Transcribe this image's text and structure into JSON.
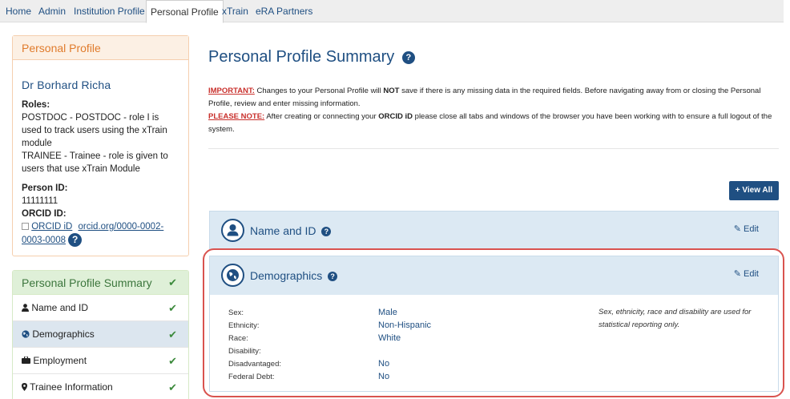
{
  "topnav": {
    "tabs": [
      "Home",
      "Admin",
      "Institution Profile",
      "Personal Profile",
      "xTrain",
      "eRA Partners"
    ],
    "active": "Personal Profile"
  },
  "profile": {
    "header": "Personal Profile",
    "name": "Dr Borhard  Richa",
    "roles_label": "Roles:",
    "roles": [
      "POSTDOC - POSTDOC - role I is used to track users using the xTrain module",
      "TRAINEE - Trainee - role is given to users that use xTrain Module"
    ],
    "person_id_label": "Person ID:",
    "person_id": "11111111",
    "orcid_label": "ORCID ID:",
    "orcid_img_alt": "ORCID iD",
    "orcid_link": "orcid.org/0000-0002-0003-0008",
    "orcid_help": "?"
  },
  "leftnav": {
    "header": "Personal Profile Summary",
    "items": [
      {
        "label": "Name and ID",
        "icon": "user-icon"
      },
      {
        "label": "Demographics",
        "icon": "globe-icon"
      },
      {
        "label": "Employment",
        "icon": "briefcase-icon"
      },
      {
        "label": "Trainee Information",
        "icon": "map-marker-icon"
      }
    ],
    "check": "✔"
  },
  "main": {
    "title": "Personal Profile Summary",
    "help": "?",
    "important_label": "IMPORTANT:",
    "important_text_1": " Changes to your Personal Profile will ",
    "important_not": "NOT",
    "important_text_2": " save if there is any missing data in the required fields. Before navigating away from or closing the Personal Profile, review and enter missing information.",
    "please_note_label": "PLEASE NOTE:",
    "please_note_text_1": " After creating or connecting your ",
    "please_note_orcid": "ORCID iD",
    "please_note_text_2": " please close all tabs and windows of the browser you have been working with to ensure a full logout of the system.",
    "view_all": "View All",
    "view_all_plus": "+",
    "edit_label": "Edit",
    "edit_icon": "✎"
  },
  "panels": {
    "name_id": {
      "title": "Name and ID",
      "help": "?"
    },
    "demographics": {
      "title": "Demographics",
      "help": "?",
      "rows": [
        {
          "label": "Sex:",
          "value": "Male"
        },
        {
          "label": "Ethnicity:",
          "value": "Non-Hispanic"
        },
        {
          "label": "Race:",
          "value": "White"
        },
        {
          "label": "Disability:",
          "value": ""
        },
        {
          "label": "Disadvantaged:",
          "value": "No"
        },
        {
          "label": "Federal Debt:",
          "value": "No"
        }
      ],
      "note": "Sex, ethnicity, race and disability are used for statistical reporting only."
    }
  },
  "colors": {
    "primary": "#1f4f82",
    "warning_red": "#c9302c",
    "highlight": "#d9534f",
    "success_green": "#3c763d"
  }
}
